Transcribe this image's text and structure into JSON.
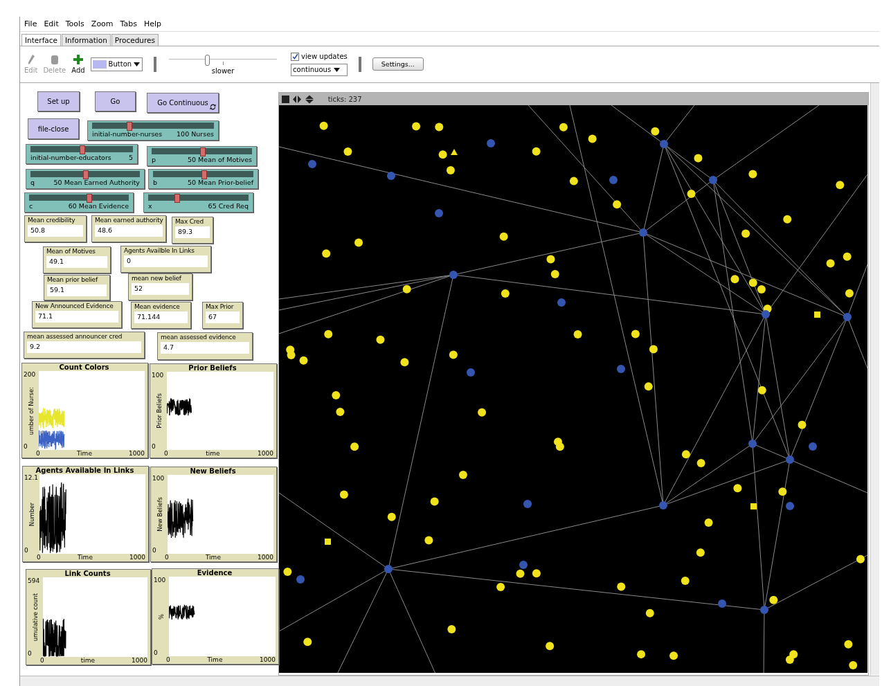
{
  "menu": [
    "File",
    "Edit",
    "Tools",
    "Zoom",
    "Tabs",
    "Help"
  ],
  "tabs": [
    {
      "label": "Interface",
      "selected": true
    },
    {
      "label": "Information",
      "selected": false
    },
    {
      "label": "Procedures",
      "selected": false
    }
  ],
  "toolbar": {
    "tools": [
      {
        "label": "Edit",
        "disabled": true
      },
      {
        "label": "Delete",
        "disabled": true
      },
      {
        "label": "Add",
        "disabled": false
      }
    ],
    "widget_type": "Button",
    "speed": {
      "label": "slower",
      "level": 0.33
    },
    "view_updates": {
      "label": "view updates",
      "checked": true
    },
    "update_mode": "continuous",
    "settings": "Settings..."
  },
  "buttons": [
    {
      "label": "Set up",
      "forever": false
    },
    {
      "label": "Go",
      "forever": false
    },
    {
      "label": "Go Continuous",
      "forever": true
    },
    {
      "label": "file-close",
      "forever": false
    }
  ],
  "sliders": [
    {
      "variable": "initial-number-nurses",
      "value": "100 Nurses",
      "level": 0.3
    },
    {
      "variable": "initial-number-educators",
      "value": "5",
      "level": 0.5
    },
    {
      "variable": "p",
      "value": "50 Mean of Motives",
      "level": 0.5
    },
    {
      "variable": "q",
      "value": "50 Mean Earned Authority",
      "level": 0.5
    },
    {
      "variable": "b",
      "value": "50 Mean Prior-belief",
      "level": 0.5
    },
    {
      "variable": "c",
      "value": "60 Mean Evidence",
      "level": 0.6
    },
    {
      "variable": "x",
      "value": "65 Cred Req",
      "level": 0.28
    }
  ],
  "monitors": [
    {
      "label": "Mean credibility",
      "value": "50.8"
    },
    {
      "label": "Mean earned authority",
      "value": "48.6"
    },
    {
      "label": "Max Cred",
      "value": "89.3"
    },
    {
      "label": "Mean  of Motives",
      "value": "49.1"
    },
    {
      "label": "Agents Availble In Links",
      "value": "0"
    },
    {
      "label": "Mean prior belief",
      "value": "59.1"
    },
    {
      "label": "mean new belief",
      "value": "52"
    },
    {
      "label": "New Announced Evidence",
      "value": "71.1"
    },
    {
      "label": "Mean evidence",
      "value": "71.144"
    },
    {
      "label": "Max Prior",
      "value": "67"
    },
    {
      "label": "mean assessed announcer cred",
      "value": "9.2"
    },
    {
      "label": "mean assessed evidence",
      "value": "4.7"
    }
  ],
  "plots": [
    {
      "title": "Count Colors",
      "ylabel": "umber of Nurse:",
      "xlabel": "Time",
      "ymin": "0",
      "ymax": "200",
      "xmin": "0",
      "xmax": "1000",
      "pens": [
        {
          "color": "#e6e62e"
        },
        {
          "color": "#3b62c4"
        }
      ]
    },
    {
      "title": "Prior Beliefs",
      "ylabel": "Prior Beliefs",
      "xlabel": "time",
      "ymin": "0",
      "ymax": "100",
      "xmin": "0",
      "xmax": "1000",
      "pens": [
        {
          "color": "#000000"
        }
      ]
    },
    {
      "title": "Agents Available In Links",
      "ylabel": "Number",
      "xlabel": "Time",
      "ymin": "0",
      "ymax": "12.1",
      "xmin": "0",
      "xmax": "1000",
      "pens": [
        {
          "color": "#000000"
        }
      ]
    },
    {
      "title": "New Beliefs",
      "ylabel": "New Beliefs",
      "xlabel": "Time",
      "ymin": "0",
      "ymax": "100",
      "xmin": "0",
      "xmax": "1000",
      "pens": [
        {
          "color": "#000000"
        }
      ]
    },
    {
      "title": "Link Counts",
      "ylabel": "umulative count",
      "xlabel": "time",
      "ymin": "0",
      "ymax": "594",
      "xmin": "0",
      "xmax": "1000",
      "pens": [
        {
          "color": "#000000"
        }
      ]
    },
    {
      "title": "Evidence",
      "ylabel": "%",
      "xlabel": "Time",
      "ymin": "0",
      "ymax": "100",
      "xmin": "0",
      "xmax": "1000",
      "pens": [
        {
          "color": "#000000"
        }
      ]
    }
  ],
  "view": {
    "ticks": "ticks: 237"
  }
}
